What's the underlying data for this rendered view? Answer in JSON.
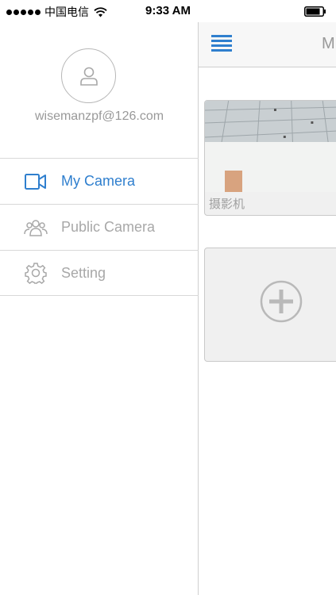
{
  "status_bar": {
    "carrier": "中国电信",
    "time": "9:33 AM"
  },
  "drawer": {
    "account_email": "wisemanzpf@126.com",
    "menu": [
      {
        "label": "My Camera",
        "icon": "video-camera-icon",
        "active": true
      },
      {
        "label": "Public Camera",
        "icon": "people-icon",
        "active": false
      },
      {
        "label": "Setting",
        "icon": "gear-icon",
        "active": false
      }
    ]
  },
  "main": {
    "title_fragment": "M",
    "cameras": [
      {
        "name": "摄影机"
      }
    ]
  },
  "colors": {
    "accent": "#2f7fce",
    "muted_text": "#a8a8a8",
    "divider": "#d8d8d8"
  }
}
